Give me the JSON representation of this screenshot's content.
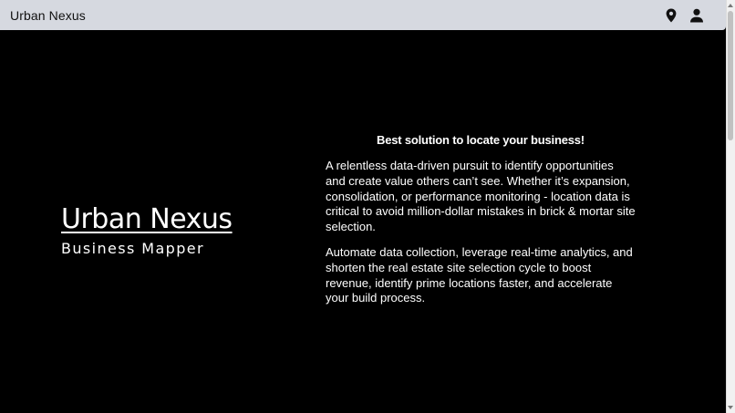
{
  "appbar": {
    "title": "Urban Nexus",
    "icons": [
      "location-pin-icon",
      "account-icon"
    ]
  },
  "hero": {
    "brand_title": "Urban Nexus",
    "brand_subtitle": "Business Mapper",
    "tagline": "Best solution to locate your business!",
    "paragraphs": [
      "A relentless data-driven pursuit to identify opportunities and create value others can’t see. Whether it’s expansion, consolidation, or performance monitoring - location data is critical to avoid million-dollar mistakes in brick & mortar site selection.",
      "Automate data collection, leverage real-time analytics, and shorten the real estate site selection cycle to boost revenue, identify prime locations faster, and accelerate your build process."
    ]
  },
  "colors": {
    "appbar_background": "#d6d9e0",
    "page_background": "#000000",
    "text_light": "#ffffff",
    "text_dark": "#111111"
  }
}
